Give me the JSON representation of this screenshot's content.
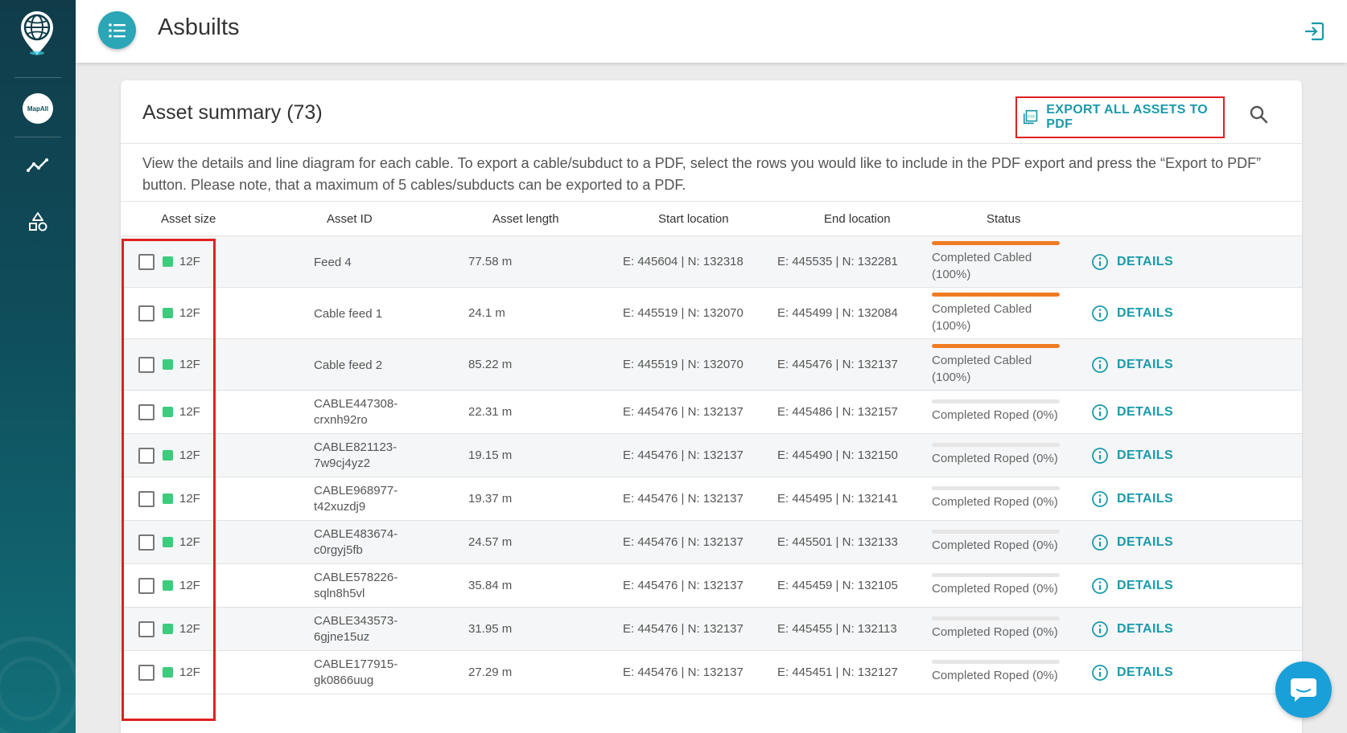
{
  "app": {
    "page_title": "Asbuilts",
    "brand_badge": "MapAll"
  },
  "sidebar": {
    "items": [
      {
        "name": "mapall-badge",
        "icon": "mapall-logo"
      },
      {
        "name": "analytics",
        "icon": "trend-line-icon"
      },
      {
        "name": "shapes",
        "icon": "shapes-icon"
      }
    ]
  },
  "card": {
    "title": "Asset summary (73)",
    "export_label": "EXPORT ALL ASSETS TO PDF",
    "description": "View the details and line diagram for each cable. To export a cable/subduct to a PDF, select the rows you would like to include in the PDF export and press the “Export to PDF” button. Please note, that a maximum of 5 cables/subducts can be exported to a PDF."
  },
  "table": {
    "headers": {
      "asset_size": "Asset size",
      "asset_id": "Asset ID",
      "asset_length": "Asset length",
      "start_location": "Start location",
      "end_location": "End location",
      "status": "Status"
    },
    "details_label": "DETAILS",
    "rows": [
      {
        "size": "12F",
        "id1": "Feed 4",
        "id2": "",
        "length": "77.58 m",
        "start": "E: 445604 | N: 132318",
        "end": "E: 445535 | N: 132281",
        "status1": "Completed Cabled",
        "status2": "(100%)",
        "progress": 1.0
      },
      {
        "size": "12F",
        "id1": "Cable feed 1",
        "id2": "",
        "length": "24.1 m",
        "start": "E: 445519 | N: 132070",
        "end": "E: 445499 | N: 132084",
        "status1": "Completed Cabled",
        "status2": "(100%)",
        "progress": 1.0
      },
      {
        "size": "12F",
        "id1": "Cable feed 2",
        "id2": "",
        "length": "85.22 m",
        "start": "E: 445519 | N: 132070",
        "end": "E: 445476 | N: 132137",
        "status1": "Completed Cabled",
        "status2": "(100%)",
        "progress": 1.0
      },
      {
        "size": "12F",
        "id1": "CABLE447308-",
        "id2": "crxnh92ro",
        "length": "22.31 m",
        "start": "E: 445476 | N: 132137",
        "end": "E: 445486 | N: 132157",
        "status1": "Completed Roped (0%)",
        "status2": "",
        "progress": 0
      },
      {
        "size": "12F",
        "id1": "CABLE821123-",
        "id2": "7w9cj4yz2",
        "length": "19.15 m",
        "start": "E: 445476 | N: 132137",
        "end": "E: 445490 | N: 132150",
        "status1": "Completed Roped (0%)",
        "status2": "",
        "progress": 0
      },
      {
        "size": "12F",
        "id1": "CABLE968977-",
        "id2": "t42xuzdj9",
        "length": "19.37 m",
        "start": "E: 445476 | N: 132137",
        "end": "E: 445495 | N: 132141",
        "status1": "Completed Roped (0%)",
        "status2": "",
        "progress": 0
      },
      {
        "size": "12F",
        "id1": "CABLE483674-",
        "id2": "c0rgyj5fb",
        "length": "24.57 m",
        "start": "E: 445476 | N: 132137",
        "end": "E: 445501 | N: 132133",
        "status1": "Completed Roped (0%)",
        "status2": "",
        "progress": 0
      },
      {
        "size": "12F",
        "id1": "CABLE578226-",
        "id2": "sqln8h5vl",
        "length": "35.84 m",
        "start": "E: 445476 | N: 132137",
        "end": "E: 445459 | N: 132105",
        "status1": "Completed Roped (0%)",
        "status2": "",
        "progress": 0
      },
      {
        "size": "12F",
        "id1": "CABLE343573-",
        "id2": "6gjne15uz",
        "length": "31.95 m",
        "start": "E: 445476 | N: 132137",
        "end": "E: 445455 | N: 132113",
        "status1": "Completed Roped (0%)",
        "status2": "",
        "progress": 0
      },
      {
        "size": "12F",
        "id1": "CABLE177915-",
        "id2": "gk0866uug",
        "length": "27.29 m",
        "start": "E: 445476 | N: 132137",
        "end": "E: 445451 | N: 132127",
        "status1": "Completed Roped (0%)",
        "status2": "",
        "progress": 0
      }
    ]
  },
  "colors": {
    "accent": "#1a9aaa",
    "progress": "#f07c22",
    "size_marker": "#3ecb7d",
    "highlight": "#e02020"
  }
}
